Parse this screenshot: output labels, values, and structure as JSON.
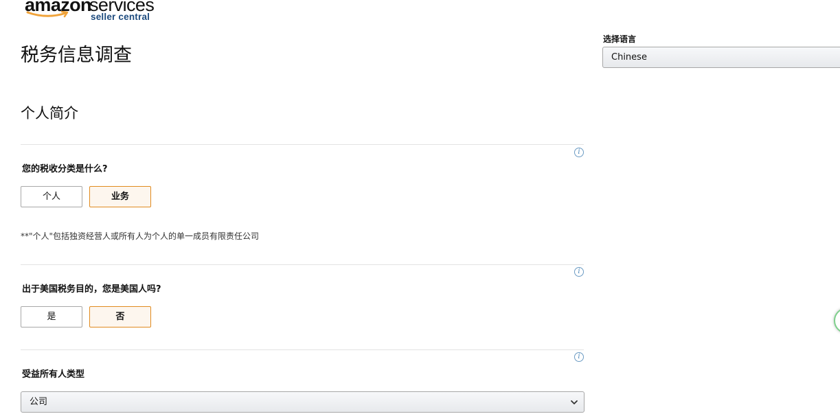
{
  "logo": {
    "amazon": "amazon",
    "services": "services",
    "sub": "seller central",
    "smile_color": "#f0a33a"
  },
  "page": {
    "title": "税务信息调查",
    "section_title": "个人简介"
  },
  "language": {
    "label": "选择语言",
    "selected": "Chinese"
  },
  "questions": {
    "tax_classification": {
      "label": "您的税收分类是什么?",
      "options": [
        "个人",
        "业务"
      ],
      "selected": "业务"
    },
    "note": "**\"个人\"包括独资经营人或所有人为个人的单一成员有限责任公司",
    "us_person": {
      "label": "出于美国税务目的，您是美国人吗?",
      "options": [
        "是",
        "否"
      ],
      "selected": "否"
    },
    "beneficial_owner": {
      "label": "受益所有人类型",
      "selected": "公司"
    }
  },
  "icons": {
    "info": "i"
  },
  "colors": {
    "selected_border": "#e08a1e",
    "selected_bg": "#fdf6ee",
    "info_icon": "#4a86b8",
    "fab_border": "#7ed08c"
  }
}
